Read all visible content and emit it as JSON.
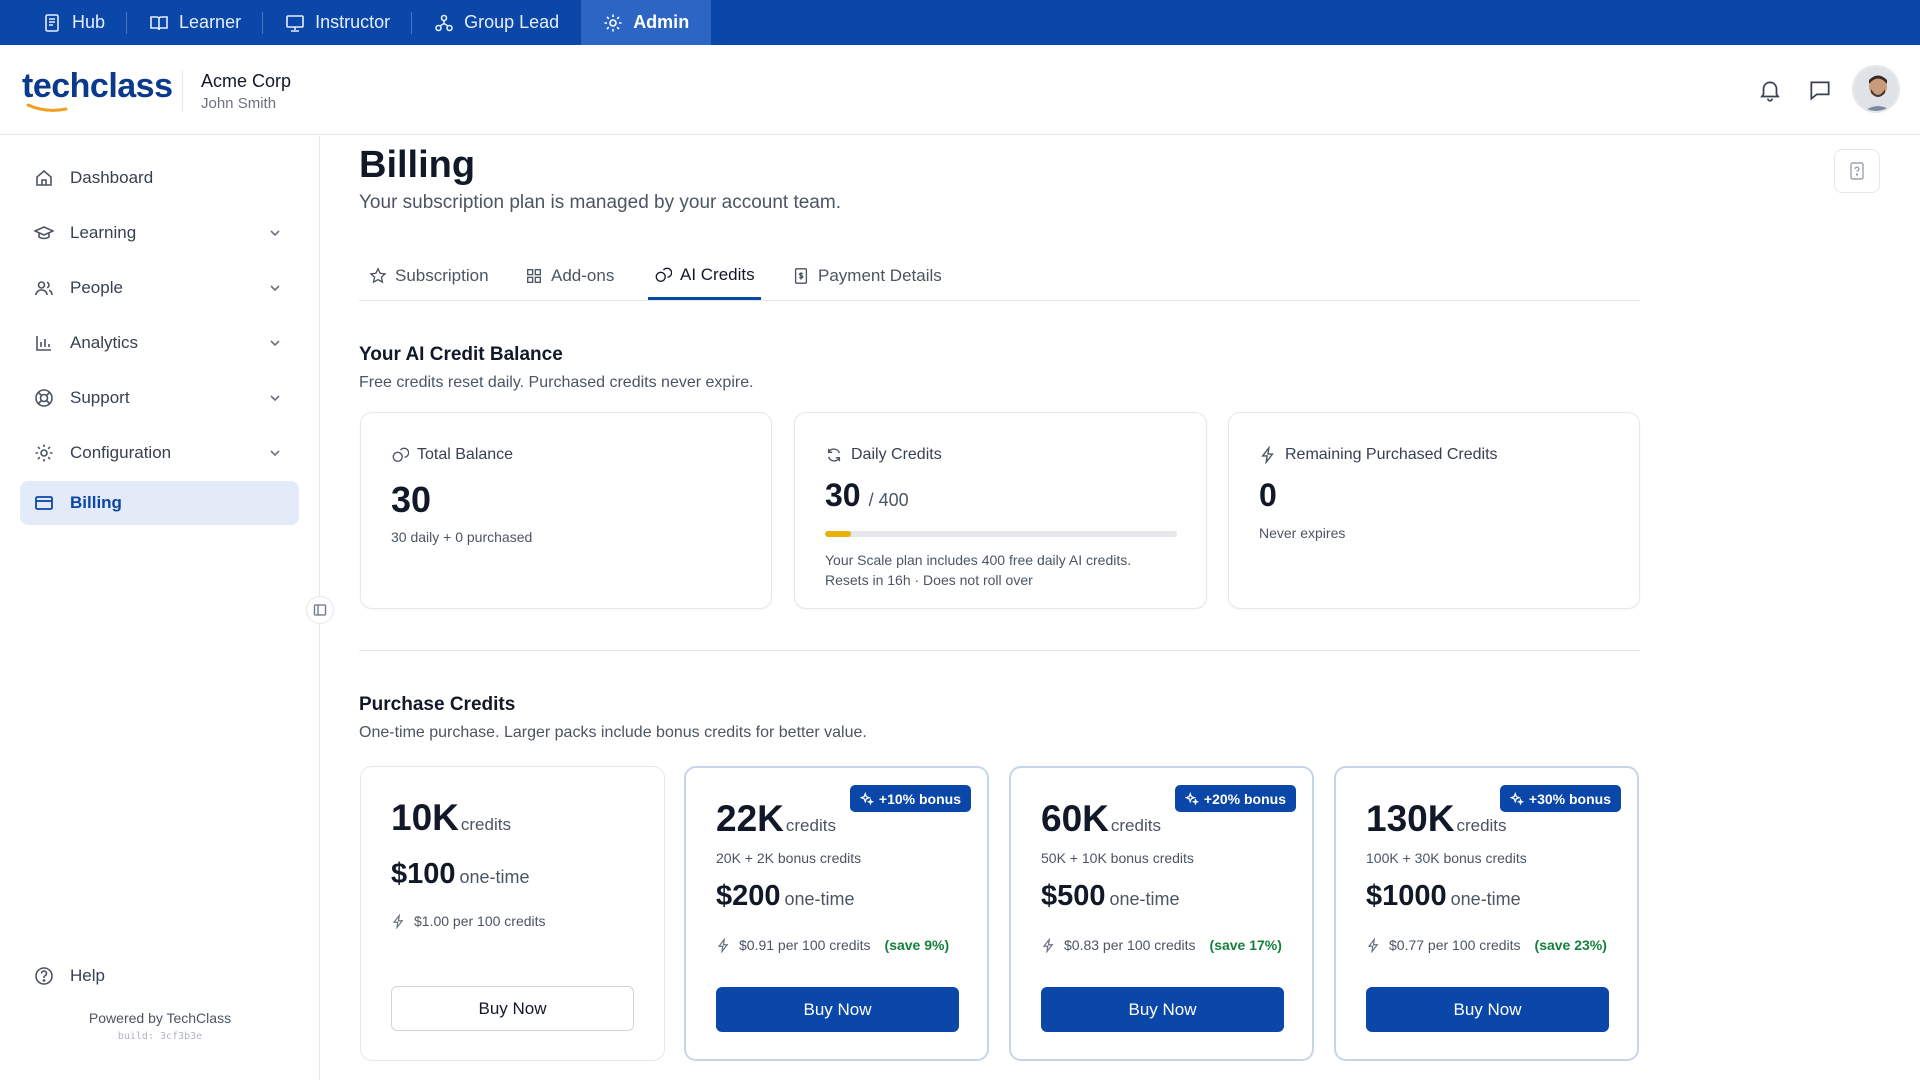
{
  "roles": [
    {
      "label": "Hub",
      "icon": "hub-icon"
    },
    {
      "label": "Learner",
      "icon": "book-icon"
    },
    {
      "label": "Instructor",
      "icon": "presentation-icon"
    },
    {
      "label": "Group Lead",
      "icon": "group-icon"
    },
    {
      "label": "Admin",
      "icon": "gear-icon",
      "active": true
    }
  ],
  "header": {
    "logo": "techclass",
    "org_name": "Acme Corp",
    "user_name": "John Smith"
  },
  "sidebar": {
    "items": [
      {
        "label": "Dashboard",
        "icon": "home-icon"
      },
      {
        "label": "Learning",
        "icon": "graduation-cap-icon",
        "expandable": true
      },
      {
        "label": "People",
        "icon": "users-icon",
        "expandable": true
      },
      {
        "label": "Analytics",
        "icon": "bar-chart-icon",
        "expandable": true
      },
      {
        "label": "Support",
        "icon": "lifebuoy-icon",
        "expandable": true
      },
      {
        "label": "Configuration",
        "icon": "gear-icon",
        "expandable": true
      },
      {
        "label": "Billing",
        "icon": "credit-card-icon",
        "active": true
      }
    ],
    "help": "Help",
    "powered_by": "Powered by TechClass",
    "build": "build: 3cf3b3e"
  },
  "page": {
    "title": "Billing",
    "subtitle": "Your subscription plan is managed by your account team."
  },
  "tabs": [
    {
      "label": "Subscription",
      "icon": "star-icon"
    },
    {
      "label": "Add-ons",
      "icon": "grid-icon"
    },
    {
      "label": "AI Credits",
      "icon": "coins-icon",
      "active": true
    },
    {
      "label": "Payment Details",
      "icon": "receipt-icon"
    }
  ],
  "balance": {
    "title": "Your AI Credit Balance",
    "subtitle": "Free credits reset daily. Purchased credits never expire.",
    "total": {
      "label": "Total Balance",
      "value": "30",
      "note": "30 daily + 0 purchased"
    },
    "daily": {
      "label": "Daily Credits",
      "value": "30",
      "of_total": "/ 400",
      "progress_fraction": 0.075,
      "note_line1": "Your Scale plan includes 400 free daily AI credits.",
      "note_line2": "Resets in 16h · Does not roll over"
    },
    "remaining": {
      "label": "Remaining Purchased Credits",
      "value": "0",
      "note": "Never expires"
    }
  },
  "purchase": {
    "title": "Purchase Credits",
    "subtitle": "One-time purchase. Larger packs include bonus credits for better value.",
    "credits_unit": "credits",
    "one_time": "one-time",
    "packs": [
      {
        "amount": "10K",
        "bonus_line": "",
        "badge": "",
        "price": "$100",
        "rate": "$1.00 per 100 credits",
        "save": "",
        "button": "Buy Now"
      },
      {
        "amount": "22K",
        "bonus_line": "20K + 2K bonus credits",
        "badge": "+10% bonus",
        "price": "$200",
        "rate": "$0.91 per 100 credits",
        "save": "(save 9%)",
        "button": "Buy Now"
      },
      {
        "amount": "60K",
        "bonus_line": "50K + 10K bonus credits",
        "badge": "+20% bonus",
        "price": "$500",
        "rate": "$0.83 per 100 credits",
        "save": "(save 17%)",
        "button": "Buy Now"
      },
      {
        "amount": "130K",
        "bonus_line": "100K + 30K bonus credits",
        "badge": "+30% bonus",
        "price": "$1000",
        "rate": "$0.77 per 100 credits",
        "save": "(save 23%)",
        "button": "Buy Now"
      }
    ]
  },
  "colors": {
    "brand": "#0a47a9",
    "accent_orange": "#f0a020",
    "progress": "#e8b10a",
    "save_green": "#15803d"
  }
}
